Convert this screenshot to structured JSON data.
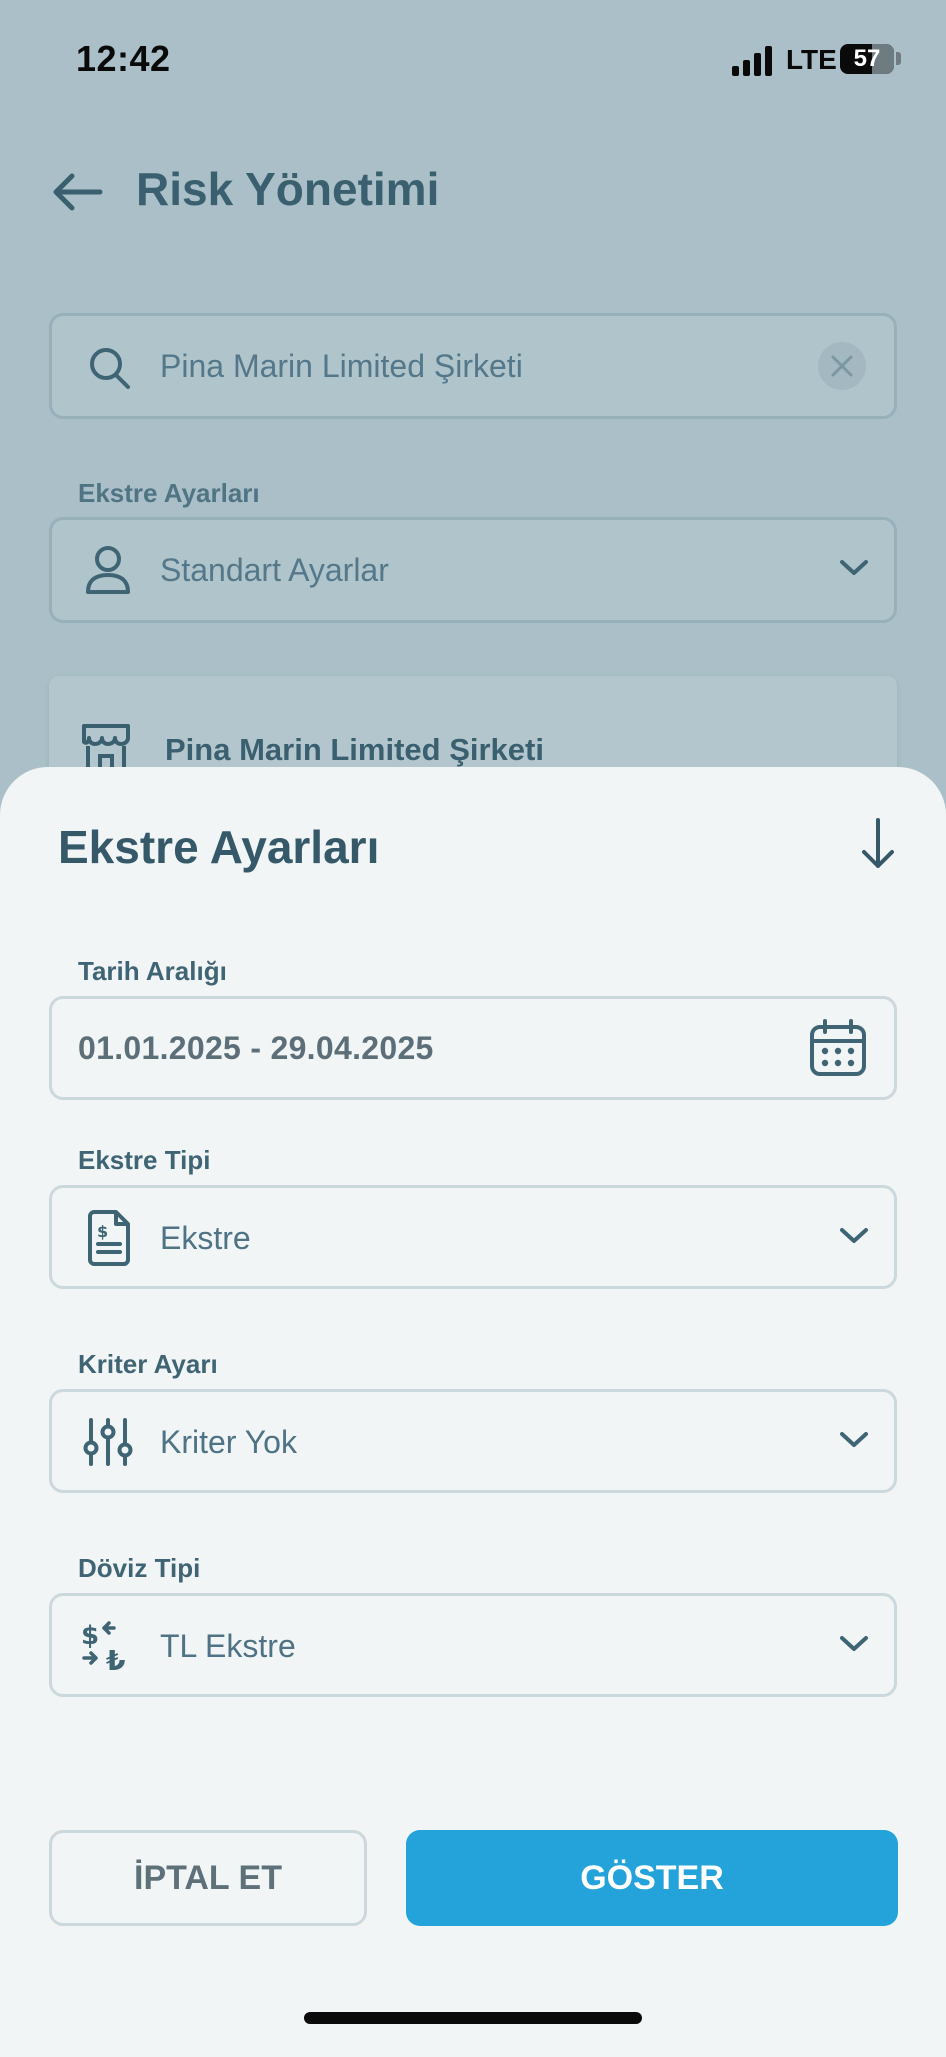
{
  "status_bar": {
    "time": "12:42",
    "network": "LTE",
    "battery": "57"
  },
  "header": {
    "title": "Risk Yönetimi",
    "back_icon": "arrow-left-icon"
  },
  "search": {
    "value": "Pina Marin Limited Şirketi",
    "icon": "search-icon",
    "clear_icon": "close-icon"
  },
  "statement_settings": {
    "label": "Ekstre Ayarları",
    "value": "Standart Ayarlar",
    "icon": "user-icon"
  },
  "company_card": {
    "title": "Pina Marin Limited Şirketi",
    "icon": "store-icon"
  },
  "sheet": {
    "title": "Ekstre Ayarları",
    "close_icon": "arrow-down-icon",
    "date_range": {
      "label": "Tarih Aralığı",
      "value": "01.01.2025 - 29.04.2025",
      "icon": "calendar-icon"
    },
    "statement_type": {
      "label": "Ekstre Tipi",
      "value": "Ekstre",
      "icon": "invoice-icon"
    },
    "criteria": {
      "label": "Kriter Ayarı",
      "value": "Kriter Yok",
      "icon": "sliders-icon"
    },
    "currency": {
      "label": "Döviz Tipi",
      "value": "TL Ekstre",
      "icon": "currency-exchange-icon"
    },
    "cancel_label": "İPTAL ET",
    "show_label": "GÖSTER"
  },
  "colors": {
    "accent": "#23a3da",
    "text_primary": "#36596a",
    "overlay": "#aabfc7",
    "sheet_bg": "#f1f5f6"
  }
}
